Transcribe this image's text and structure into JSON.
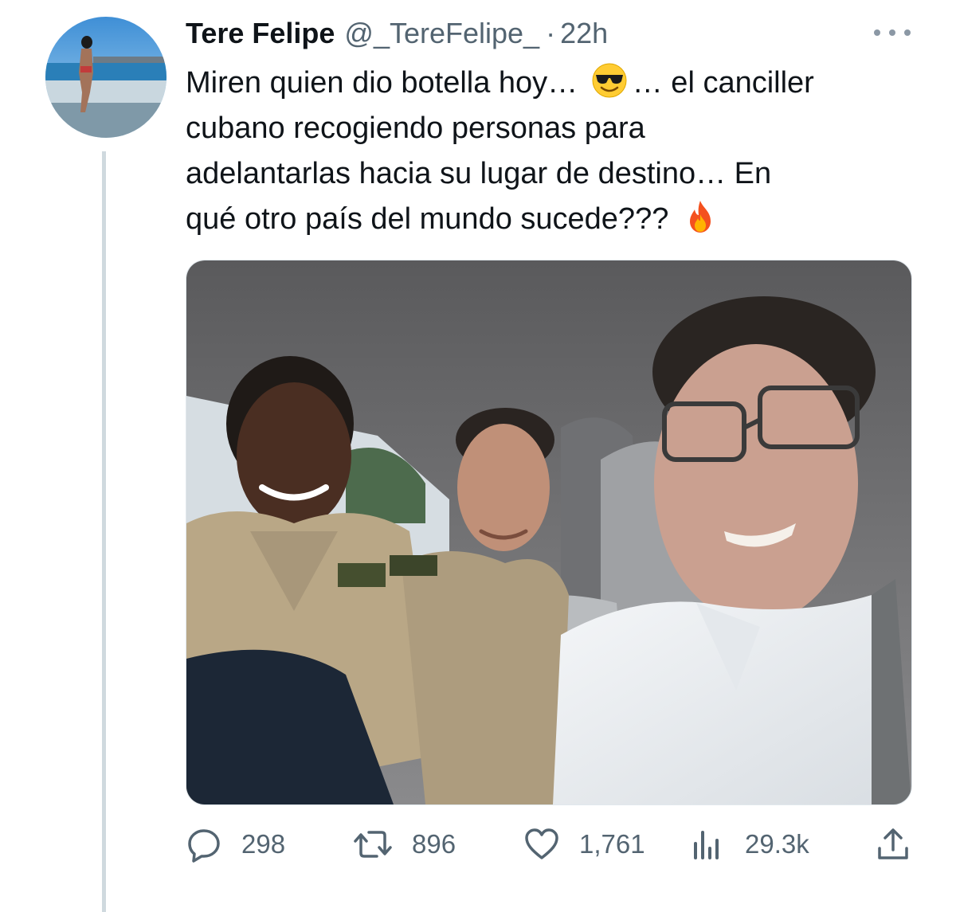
{
  "tweet": {
    "display_name": "Tere Felipe",
    "handle": "@_TereFelipe_",
    "separator": "·",
    "time": "22h",
    "text_line_1a": "Miren  quien dio botella hoy…",
    "text_line_1b": "… el canciller",
    "text_line_2": "cubano recogiendo personas para",
    "text_line_3": "adelantarlas hacia su lugar de destino… En",
    "text_line_4": "qué otro país del mundo sucede???",
    "emoji_1": "smiling-face-with-sunglasses-icon",
    "emoji_2": "fire-icon"
  },
  "actions": {
    "replies": "298",
    "retweets": "896",
    "likes": "1,761",
    "views": "29.3k"
  },
  "colors": {
    "text_primary": "#0f1419",
    "text_secondary": "#536471",
    "thread_line": "#cfd9de"
  }
}
